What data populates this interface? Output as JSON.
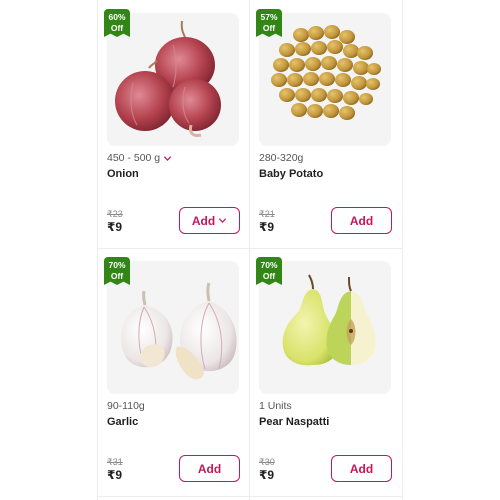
{
  "products": [
    {
      "discount_pct": "60%",
      "discount_off": "Off",
      "quantity": "450 - 500 g",
      "has_variants": true,
      "name": "Onion",
      "mrp": "₹23",
      "price": "₹9",
      "add_label": "Add",
      "image_icon": "onion-image"
    },
    {
      "discount_pct": "57%",
      "discount_off": "Off",
      "quantity": "280-320g",
      "has_variants": false,
      "name": "Baby Potato",
      "mrp": "₹21",
      "price": "₹9",
      "add_label": "Add",
      "image_icon": "potato-image"
    },
    {
      "discount_pct": "70%",
      "discount_off": "Off",
      "quantity": "90-110g",
      "has_variants": false,
      "name": "Garlic",
      "mrp": "₹31",
      "price": "₹9",
      "add_label": "Add",
      "image_icon": "garlic-image"
    },
    {
      "discount_pct": "70%",
      "discount_off": "Off",
      "quantity": "1 Units",
      "has_variants": false,
      "name": "Pear Naspatti",
      "mrp": "₹30",
      "price": "₹9",
      "add_label": "Add",
      "image_icon": "pear-image"
    }
  ],
  "colors": {
    "accent": "#c3185b",
    "badge": "#318616"
  }
}
